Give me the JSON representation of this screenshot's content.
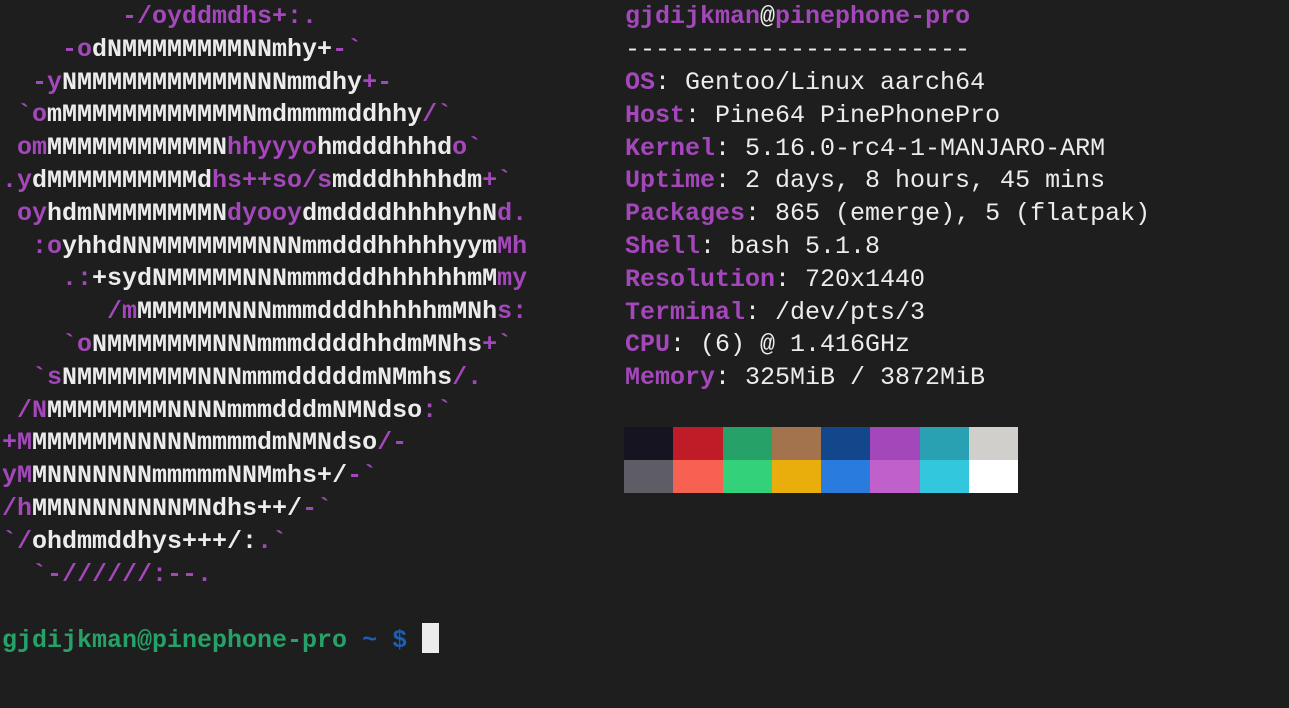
{
  "ascii_logo": [
    [
      {
        "t": "        -/oyddmdhs+:.",
        "c": "p"
      }
    ],
    [
      {
        "t": "    -o",
        "c": "p"
      },
      {
        "t": "dNMMMMMMMMNNmhy+",
        "c": "w"
      },
      {
        "t": "-`",
        "c": "p"
      }
    ],
    [
      {
        "t": "  -y",
        "c": "p"
      },
      {
        "t": "NMMMMMMMMMMMNNNmmdhy",
        "c": "w"
      },
      {
        "t": "+-",
        "c": "p"
      }
    ],
    [
      {
        "t": " `o",
        "c": "p"
      },
      {
        "t": "mMMMMMMMMMMMMNmdmmmmddhhy",
        "c": "w"
      },
      {
        "t": "/`",
        "c": "p"
      }
    ],
    [
      {
        "t": " om",
        "c": "p"
      },
      {
        "t": "MMMMMMMMMMMN",
        "c": "w"
      },
      {
        "t": "hhyyyo",
        "c": "p"
      },
      {
        "t": "hmdddhhhd",
        "c": "w"
      },
      {
        "t": "o`",
        "c": "p"
      }
    ],
    [
      {
        "t": ".y",
        "c": "p"
      },
      {
        "t": "dMMMMMMMMMMd",
        "c": "w"
      },
      {
        "t": "hs++so/s",
        "c": "p"
      },
      {
        "t": "mdddhhhhdm",
        "c": "w"
      },
      {
        "t": "+`",
        "c": "p"
      }
    ],
    [
      {
        "t": " oy",
        "c": "p"
      },
      {
        "t": "hdmNMMMMMMMN",
        "c": "w"
      },
      {
        "t": "dyooy",
        "c": "p"
      },
      {
        "t": "dmddddhhhhyhN",
        "c": "w"
      },
      {
        "t": "d.",
        "c": "p"
      }
    ],
    [
      {
        "t": "  :o",
        "c": "p"
      },
      {
        "t": "yhhdNNMMMMMMMNNNmmdddhhhhhyym",
        "c": "w"
      },
      {
        "t": "Mh",
        "c": "p"
      }
    ],
    [
      {
        "t": "    .:",
        "c": "p"
      },
      {
        "t": "+sydNMMMMMNNNmmmdddhhhhhhmM",
        "c": "w"
      },
      {
        "t": "my",
        "c": "p"
      }
    ],
    [
      {
        "t": "       /m",
        "c": "p"
      },
      {
        "t": "MMMMMMNNNmmmdddhhhhhmMNh",
        "c": "w"
      },
      {
        "t": "s:",
        "c": "p"
      }
    ],
    [
      {
        "t": "    `o",
        "c": "p"
      },
      {
        "t": "NMMMMMMMNNNmmmddddhhdmMNhs",
        "c": "w"
      },
      {
        "t": "+`",
        "c": "p"
      }
    ],
    [
      {
        "t": "  `s",
        "c": "p"
      },
      {
        "t": "NMMMMMMMMNNNmmmdddddmNMmhs",
        "c": "w"
      },
      {
        "t": "/.",
        "c": "p"
      }
    ],
    [
      {
        "t": " /N",
        "c": "p"
      },
      {
        "t": "MMMMMMMMNNNNmmmdddmNMNdso",
        "c": "w"
      },
      {
        "t": ":`",
        "c": "p"
      }
    ],
    [
      {
        "t": "+M",
        "c": "p"
      },
      {
        "t": "MMMMMMNNNNNmmmmdmNMNdso",
        "c": "w"
      },
      {
        "t": "/-",
        "c": "p"
      }
    ],
    [
      {
        "t": "yM",
        "c": "p"
      },
      {
        "t": "MNNNNNNNmmmmmNNMmhs+/",
        "c": "w"
      },
      {
        "t": "-`",
        "c": "p"
      }
    ],
    [
      {
        "t": "/h",
        "c": "p"
      },
      {
        "t": "MMNNNNNNNNMNdhs++/",
        "c": "w"
      },
      {
        "t": "-`",
        "c": "p"
      }
    ],
    [
      {
        "t": "`/",
        "c": "p"
      },
      {
        "t": "ohdmmddhys+++/:",
        "c": "w"
      },
      {
        "t": ".`",
        "c": "p"
      }
    ],
    [
      {
        "t": "  `-//////:--.",
        "c": "p"
      }
    ]
  ],
  "info": {
    "user": "gjdijkman",
    "at": "@",
    "host": "pinephone-pro",
    "separator": "-----------------------",
    "rows": [
      {
        "key": "OS",
        "value": ": Gentoo/Linux aarch64"
      },
      {
        "key": "Host",
        "value": ": Pine64 PinePhonePro"
      },
      {
        "key": "Kernel",
        "value": ": 5.16.0-rc4-1-MANJARO-ARM"
      },
      {
        "key": "Uptime",
        "value": ": 2 days, 8 hours, 45 mins"
      },
      {
        "key": "Packages",
        "value": ": 865 (emerge), 5 (flatpak)"
      },
      {
        "key": "Shell",
        "value": ": bash 5.1.8"
      },
      {
        "key": "Resolution",
        "value": ": 720x1440"
      },
      {
        "key": "Terminal",
        "value": ": /dev/pts/3"
      },
      {
        "key": "CPU",
        "value": ": (6) @ 1.416GHz"
      },
      {
        "key": "Memory",
        "value": ": 325MiB / 3872MiB"
      }
    ]
  },
  "palette": {
    "normal": [
      "#171421",
      "#c01c28",
      "#26a269",
      "#a2734c",
      "#12488b",
      "#a347ba",
      "#2aa1b3",
      "#d0cfcc"
    ],
    "bright": [
      "#5e5c64",
      "#f66151",
      "#33d17a",
      "#e9ad0c",
      "#2a7bde",
      "#c061cb",
      "#33c7de",
      "#ffffff"
    ]
  },
  "prompt": {
    "user_host": "gjdijkman@pinephone-pro",
    "path": "~",
    "symbol": "$"
  }
}
